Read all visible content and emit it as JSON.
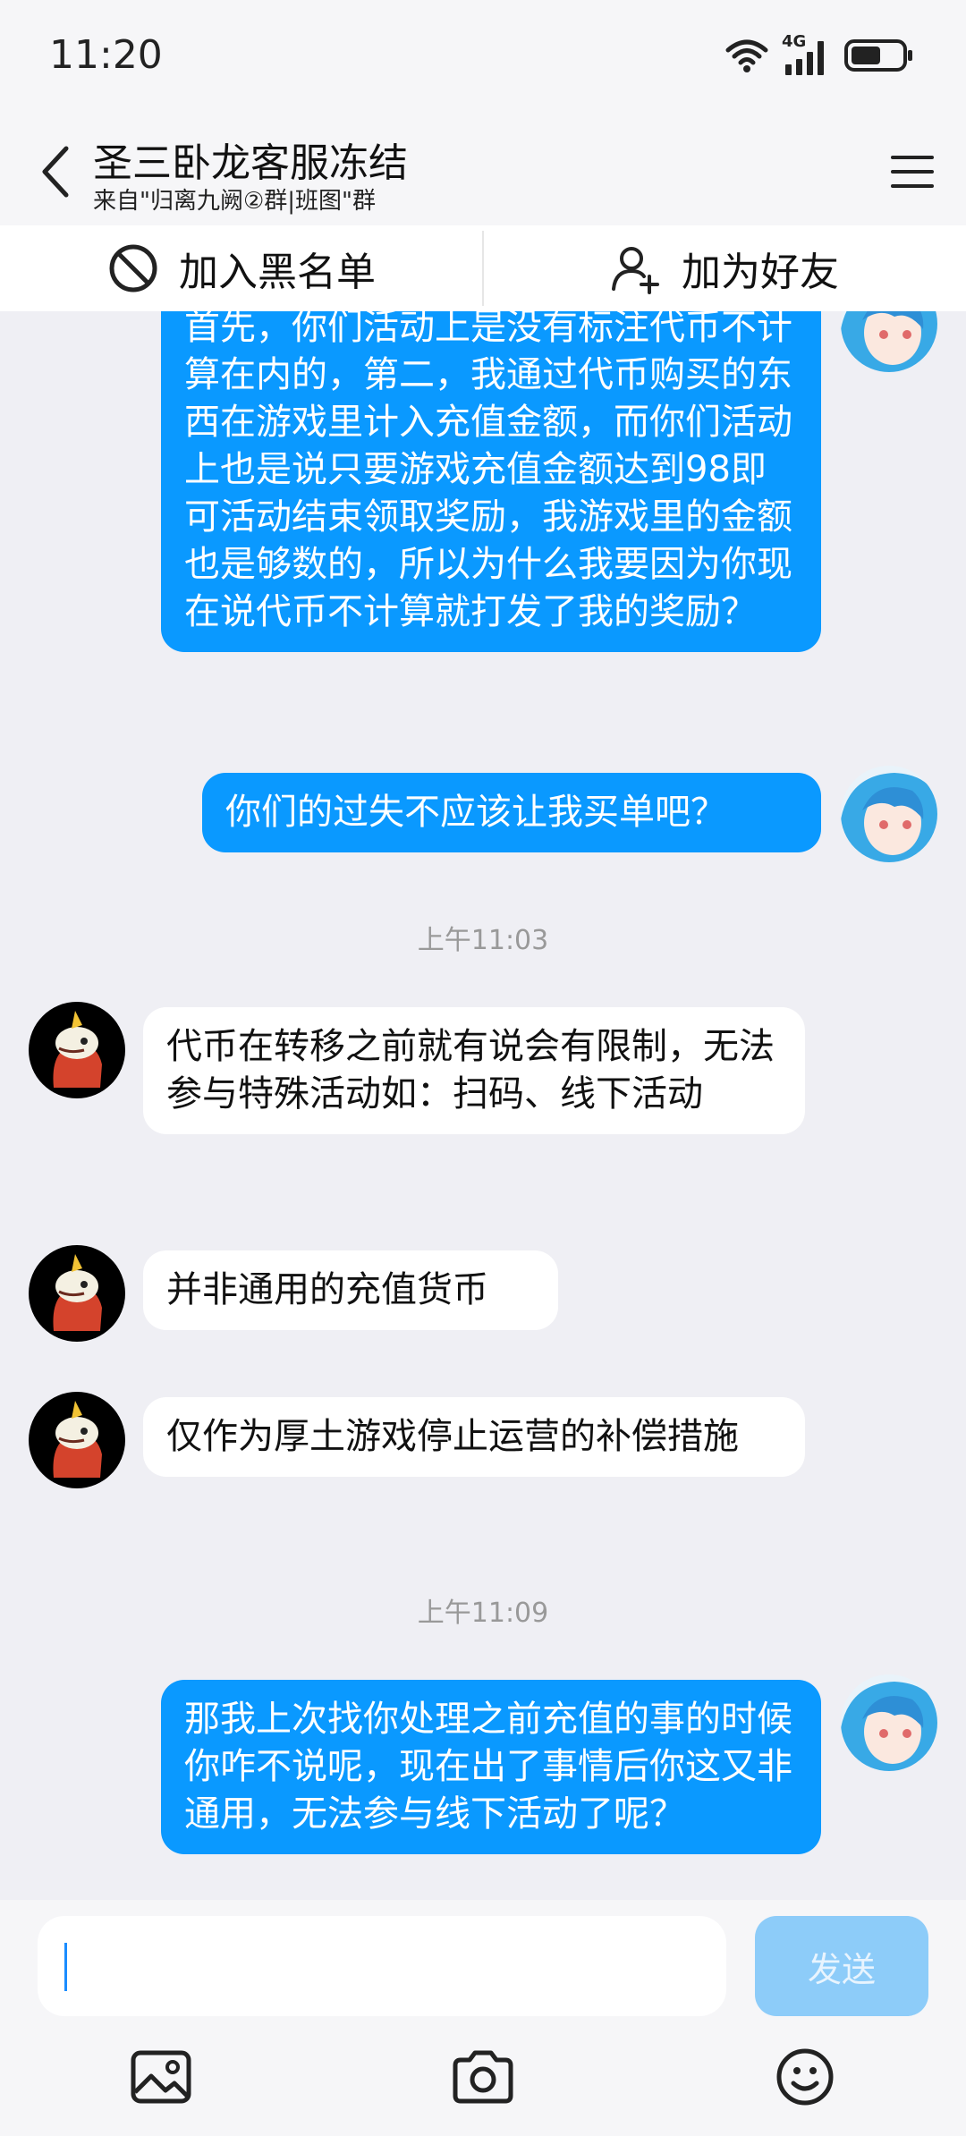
{
  "status_bar": {
    "time": "11:20",
    "network": "4G"
  },
  "header": {
    "title": "圣三卧龙客服冻结",
    "subtitle": "来自\"归离九阙②群|班图\"群"
  },
  "actions": {
    "blacklist": "加入黑名单",
    "add_friend": "加为好友"
  },
  "messages": [
    {
      "type": "out",
      "text": "首先，你们活动上是没有标注代币不计算在内的，第二，我通过代币购买的东西在游戏里计入充值金额，而你们活动上也是说只要游戏充值金额达到98即可活动结束领取奖励，我游戏里的金额也是够数的，所以为什么我要因为你现在说代币不计算就打发了我的奖励？"
    },
    {
      "type": "out",
      "text": "你们的过失不应该让我买单吧？"
    },
    {
      "type": "time",
      "text": "上午11:03"
    },
    {
      "type": "in",
      "text": "代币在转移之前就有说会有限制，无法参与特殊活动如：扫码、线下活动"
    },
    {
      "type": "in",
      "text": "并非通用的充值货币"
    },
    {
      "type": "in",
      "text": "仅作为厚土游戏停止运营的补偿措施"
    },
    {
      "type": "time",
      "text": "上午11:09"
    },
    {
      "type": "out",
      "text": "那我上次找你处理之前充值的事的时候你咋不说呢，现在出了事情后你这又非通用，无法参与线下活动了呢？"
    }
  ],
  "input_bar": {
    "placeholder": "",
    "send_label": "发送"
  },
  "colors": {
    "outgoing_bubble": "#0a99ff",
    "incoming_bubble": "#ffffff",
    "background": "#efeff4",
    "send_button": "#8dccf9"
  },
  "icons": [
    "wifi-icon",
    "signal-icon",
    "battery-icon",
    "back-icon",
    "menu-icon",
    "block-icon",
    "add-friend-icon",
    "image-icon",
    "camera-icon",
    "emoji-icon"
  ]
}
